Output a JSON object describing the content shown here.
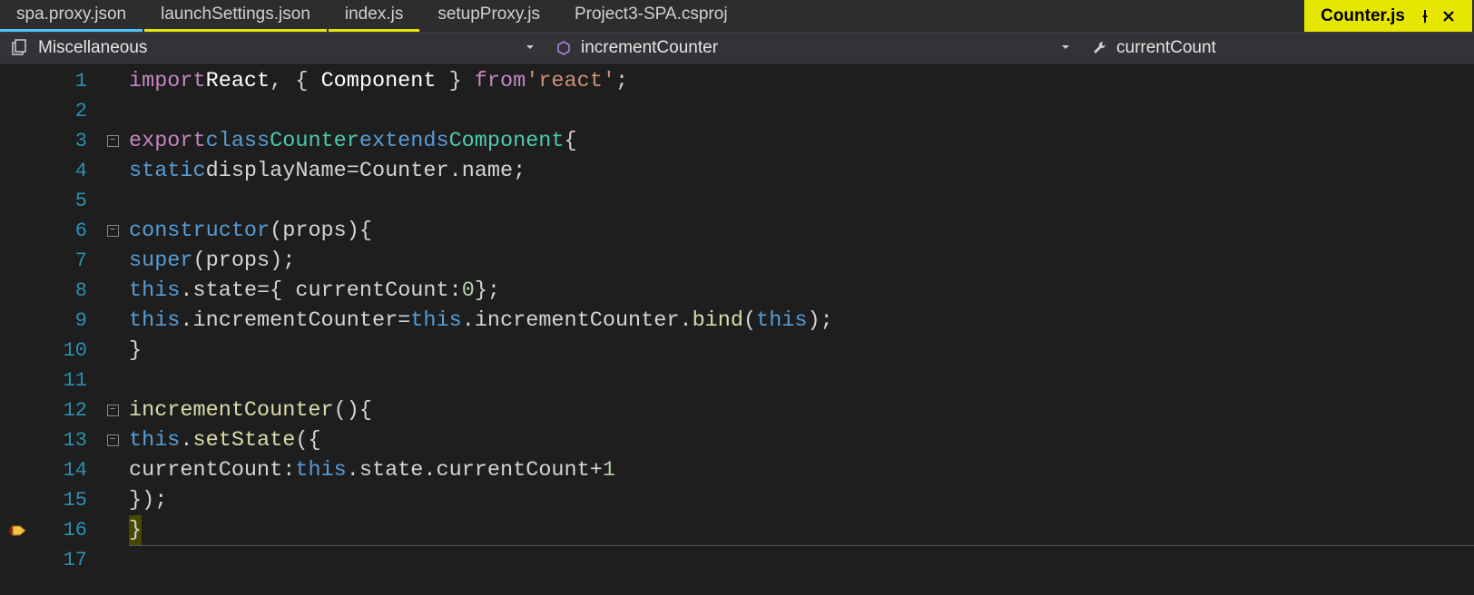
{
  "tabs": [
    {
      "label": "spa.proxy.json",
      "style": "underline-blue"
    },
    {
      "label": "launchSettings.json",
      "style": "underline-yellow"
    },
    {
      "label": "index.js",
      "style": "underline-yellow"
    },
    {
      "label": "setupProxy.js",
      "style": "underline-none"
    },
    {
      "label": "Project3-SPA.csproj",
      "style": "underline-none"
    },
    {
      "label": "Counter.js",
      "style": "active",
      "pinned": true,
      "closable": true
    }
  ],
  "navbar": {
    "scope": "Miscellaneous",
    "member": "incrementCounter",
    "field": "currentCount"
  },
  "lines": {
    "1": [
      [
        "kw2",
        "import"
      ],
      [
        "sp",
        " "
      ],
      [
        "white",
        "React"
      ],
      [
        "punc",
        ", { "
      ],
      [
        "white",
        "Component"
      ],
      [
        "punc",
        " } "
      ],
      [
        "kw2",
        "from"
      ],
      [
        "sp",
        " "
      ],
      [
        "str",
        "'react'"
      ],
      [
        "punc",
        ";"
      ]
    ],
    "2": [],
    "3": [
      [
        "kw2",
        "export"
      ],
      [
        "sp",
        " "
      ],
      [
        "kw",
        "class"
      ],
      [
        "sp",
        " "
      ],
      [
        "type",
        "Counter"
      ],
      [
        "sp",
        " "
      ],
      [
        "kw",
        "extends"
      ],
      [
        "sp",
        " "
      ],
      [
        "type",
        "Component"
      ],
      [
        "sp",
        " "
      ],
      [
        "punc",
        "{"
      ]
    ],
    "4": [
      [
        "sp",
        "  "
      ],
      [
        "kw",
        "static"
      ],
      [
        "sp",
        " "
      ],
      [
        "prop2",
        "displayName"
      ],
      [
        "sp",
        " "
      ],
      [
        "punc",
        "="
      ],
      [
        "sp",
        " "
      ],
      [
        "prop2",
        "Counter"
      ],
      [
        "punc",
        "."
      ],
      [
        "prop2",
        "name"
      ],
      [
        "punc",
        ";"
      ]
    ],
    "5": [],
    "6": [
      [
        "sp",
        "  "
      ],
      [
        "kw",
        "constructor"
      ],
      [
        "punc",
        "("
      ],
      [
        "prop2",
        "props"
      ],
      [
        "punc",
        ")"
      ],
      [
        "sp",
        " "
      ],
      [
        "punc",
        "{"
      ]
    ],
    "7": [
      [
        "sp",
        "    "
      ],
      [
        "kw",
        "super"
      ],
      [
        "punc",
        "("
      ],
      [
        "prop2",
        "props"
      ],
      [
        "punc",
        ")"
      ],
      [
        "punc",
        ";"
      ]
    ],
    "8": [
      [
        "sp",
        "    "
      ],
      [
        "this",
        "this"
      ],
      [
        "punc",
        "."
      ],
      [
        "prop2",
        "state"
      ],
      [
        "sp",
        " "
      ],
      [
        "punc",
        "="
      ],
      [
        "sp",
        " "
      ],
      [
        "punc",
        "{ "
      ],
      [
        "prop2",
        "currentCount"
      ],
      [
        "punc",
        ":"
      ],
      [
        "sp",
        " "
      ],
      [
        "num",
        "0"
      ],
      [
        "sp",
        " "
      ],
      [
        "punc",
        "};"
      ]
    ],
    "9": [
      [
        "sp",
        "    "
      ],
      [
        "this",
        "this"
      ],
      [
        "punc",
        "."
      ],
      [
        "prop2",
        "incrementCounter"
      ],
      [
        "sp",
        " "
      ],
      [
        "punc",
        "="
      ],
      [
        "sp",
        " "
      ],
      [
        "this",
        "this"
      ],
      [
        "punc",
        "."
      ],
      [
        "prop2",
        "incrementCounter"
      ],
      [
        "punc",
        "."
      ],
      [
        "func",
        "bind"
      ],
      [
        "punc",
        "("
      ],
      [
        "this",
        "this"
      ],
      [
        "punc",
        ");"
      ]
    ],
    "10": [
      [
        "sp",
        "  "
      ],
      [
        "punc",
        "}"
      ]
    ],
    "11": [],
    "12": [
      [
        "sp",
        "  "
      ],
      [
        "func",
        "incrementCounter"
      ],
      [
        "punc",
        "()"
      ],
      [
        "sp",
        " "
      ],
      [
        "punc",
        "{"
      ]
    ],
    "13": [
      [
        "sp",
        "    "
      ],
      [
        "this",
        "this"
      ],
      [
        "punc",
        "."
      ],
      [
        "func",
        "setState"
      ],
      [
        "punc",
        "({"
      ]
    ],
    "14": [
      [
        "sp",
        "      "
      ],
      [
        "prop2",
        "currentCount"
      ],
      [
        "punc",
        ":"
      ],
      [
        "sp",
        " "
      ],
      [
        "this",
        "this"
      ],
      [
        "punc",
        "."
      ],
      [
        "prop2",
        "state"
      ],
      [
        "punc",
        "."
      ],
      [
        "prop2",
        "currentCount"
      ],
      [
        "sp",
        " "
      ],
      [
        "punc",
        "+"
      ],
      [
        "sp",
        " "
      ],
      [
        "num",
        "1"
      ]
    ],
    "15": [
      [
        "sp",
        "    "
      ],
      [
        "punc",
        "});"
      ]
    ],
    "16": [
      [
        "sp",
        "  "
      ],
      [
        "hl",
        "}"
      ]
    ],
    "17": []
  },
  "lineCount": 17,
  "foldMarkers": {
    "3": "minus",
    "6": "minus",
    "12": "minus",
    "13": "minus"
  },
  "currentExecLine": 16,
  "indentGuides": [
    0,
    1,
    2
  ]
}
